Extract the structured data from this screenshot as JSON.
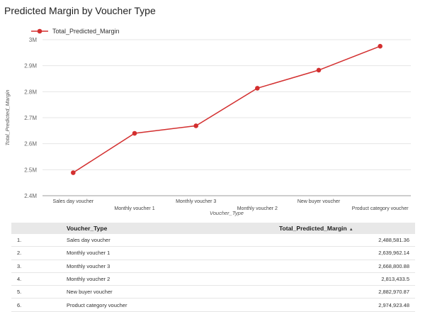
{
  "title": "Predicted Margin by Voucher Type",
  "chart_data": {
    "type": "line",
    "title": "Predicted Margin by Voucher Type",
    "categories": [
      "Sales day voucher",
      "Monthly voucher 1",
      "Monthly voucher 3",
      "Monthly voucher 2",
      "New buyer voucher",
      "Product category voucher"
    ],
    "series": [
      {
        "name": "Total_Predicted_Margin",
        "values": [
          2488581.36,
          2639962.14,
          2668800.88,
          2813433.5,
          2882970.87,
          2974923.48
        ]
      }
    ],
    "xlabel": "Voucher_Type",
    "ylabel": "Total_Predicted_Margin",
    "ylim": [
      2400000,
      3000000
    ],
    "yticks": [
      {
        "value": 2400000,
        "label": "2.4M"
      },
      {
        "value": 2500000,
        "label": "2.5M"
      },
      {
        "value": 2600000,
        "label": "2.6M"
      },
      {
        "value": 2700000,
        "label": "2.7M"
      },
      {
        "value": 2800000,
        "label": "2.8M"
      },
      {
        "value": 2900000,
        "label": "2.9M"
      },
      {
        "value": 3000000,
        "label": "3M"
      }
    ],
    "grid": true,
    "legend": "top-left",
    "color": "#d32f2f"
  },
  "table": {
    "headers": [
      "Voucher_Type",
      "Total_Predicted_Margin"
    ],
    "sort_icon": "▲",
    "rows": [
      {
        "index": "1.",
        "type": "Sales day voucher",
        "value": "2,488,581.36"
      },
      {
        "index": "2.",
        "type": "Monthly voucher 1",
        "value": "2,639,962.14"
      },
      {
        "index": "3.",
        "type": "Monthly voucher 3",
        "value": "2,668,800.88"
      },
      {
        "index": "4.",
        "type": "Monthly voucher 2",
        "value": "2,813,433.5"
      },
      {
        "index": "5.",
        "type": "New buyer voucher",
        "value": "2,882,970.87"
      },
      {
        "index": "6.",
        "type": "Product category voucher",
        "value": "2,974,923.48"
      }
    ]
  }
}
